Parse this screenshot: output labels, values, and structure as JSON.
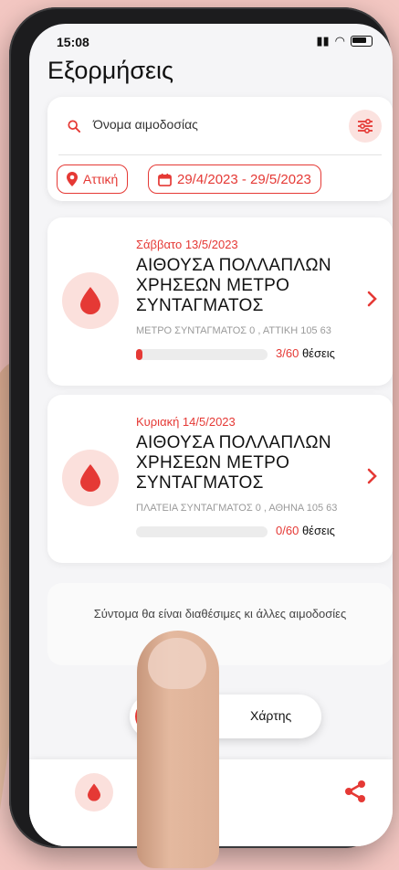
{
  "status": {
    "time": "15:08"
  },
  "header": {
    "title": "Εξορμήσεις"
  },
  "search": {
    "placeholder": "Όνομα αιμοδοσίας"
  },
  "filters": {
    "region": "Αττική",
    "date_range": "29/4/2023 - 29/5/2023"
  },
  "events": [
    {
      "date": "Σάββατο 13/5/2023",
      "title": "ΑΙΘΟΥΣΑ ΠΟΛΛΑΠΛΩΝ ΧΡΗΣΕΩΝ ΜΕΤΡΟ ΣΥΝΤΑΓΜΑΤΟΣ",
      "address": "ΜΕΤΡΟ ΣΥΝΤΑΓΜΑΤΟΣ 0 , ΑΤΤΙΚΗ 105 63",
      "seats_taken": "3/60",
      "seats_label": "θέσεις",
      "progress_fraction": 0.05
    },
    {
      "date": "Κυριακή 14/5/2023",
      "title": "ΑΙΘΟΥΣΑ ΠΟΛΛΑΠΛΩΝ ΧΡΗΣΕΩΝ ΜΕΤΡΟ ΣΥΝΤΑΓΜΑΤΟΣ",
      "address": "ΠΛΑΤΕΙΑ ΣΥΝΤΑΓΜΑΤΟΣ 0 , ΑΘΗΝΑ 105 63",
      "seats_taken": "0/60",
      "seats_label": "θέσεις",
      "progress_fraction": 0.0
    }
  ],
  "info": {
    "message": "Σύντομα θα είναι διαθέσιμες κι άλλες αιμοδοσίες"
  },
  "fab": {
    "map_label": "Χάρτης"
  },
  "colors": {
    "accent": "#e53935",
    "accent_soft": "#fbe0dc"
  },
  "icons": [
    "search-icon",
    "filter-icon",
    "location-pin-icon",
    "calendar-icon",
    "blood-drop-icon",
    "chevron-right-icon",
    "list-icon",
    "share-icon"
  ]
}
